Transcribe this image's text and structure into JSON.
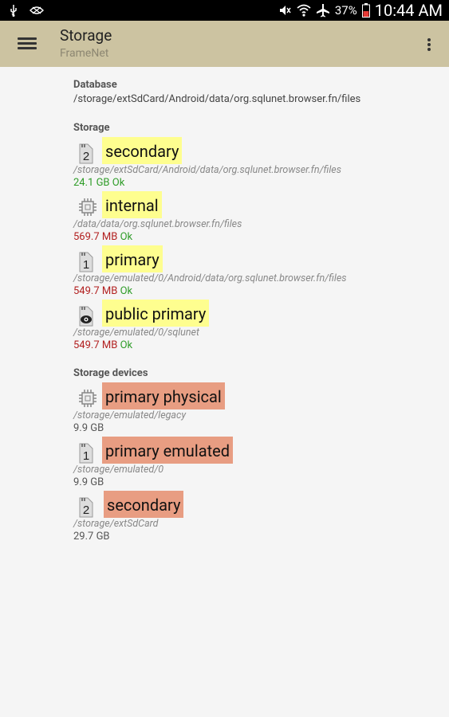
{
  "status_bar": {
    "battery": "37%",
    "time": "10:44 AM"
  },
  "app_bar": {
    "title": "Storage",
    "subtitle": "FrameNet"
  },
  "database": {
    "label": "Database",
    "path": "/storage/extSdCard/Android/data/org.sqlunet.browser.fn/files"
  },
  "storage": {
    "label": "Storage",
    "items": [
      {
        "name": "secondary",
        "icon": "sd-card-2-icon",
        "path": "/storage/extSdCard/Android/data/org.sqlunet.browser.fn/files",
        "size": "24.1 GB",
        "status": "Ok"
      },
      {
        "name": "internal",
        "icon": "chip-icon",
        "path": "/data/data/org.sqlunet.browser.fn/files",
        "size": "569.7 MB",
        "status": "Ok"
      },
      {
        "name": "primary",
        "icon": "sd-card-1-icon",
        "path": "/storage/emulated/0/Android/data/org.sqlunet.browser.fn/files",
        "size": "549.7 MB",
        "status": "Ok"
      },
      {
        "name": "public primary",
        "icon": "eye-card-icon",
        "path": "/storage/emulated/0/sqlunet",
        "size": "549.7 MB",
        "status": "Ok"
      }
    ]
  },
  "devices": {
    "label": "Storage devices",
    "items": [
      {
        "name": "primary physical",
        "icon": "chip-icon",
        "path": "/storage/emulated/legacy",
        "size": "9.9 GB"
      },
      {
        "name": "primary emulated",
        "icon": "sd-card-1-icon",
        "path": "/storage/emulated/0",
        "size": "9.9 GB"
      },
      {
        "name": "secondary",
        "icon": "sd-card-2-icon",
        "path": "/storage/extSdCard",
        "size": "29.7 GB"
      }
    ]
  },
  "colors": {
    "app_bar": "#ccc3a1",
    "storage_highlight": "#fefe8f",
    "device_highlight": "#e89d82"
  }
}
